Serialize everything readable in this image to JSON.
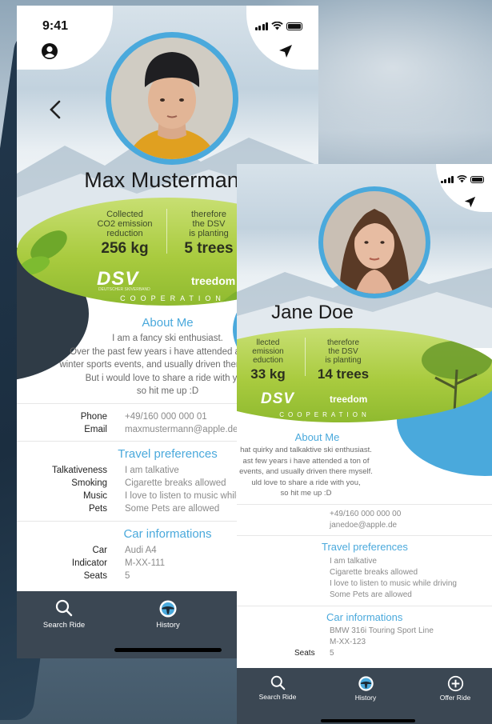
{
  "app": {
    "tabs": [
      {
        "label": "Search Ride",
        "icon": "search-icon"
      },
      {
        "label": "History",
        "icon": "steering-wheel-icon"
      },
      {
        "label": "Offer Ride",
        "icon": "plus-circle-icon"
      }
    ],
    "accent": "#4aa9dc",
    "tabbar_color": "#3b4753"
  },
  "profile1": {
    "time": "9:41",
    "name": "Max Mustermann",
    "eco": {
      "collected_label": "Collected\nCO2 emission\nreduction",
      "collected_value": "256 kg",
      "planting_label": "therefore\nthe DSV\nis planting",
      "planting_value": "5 trees",
      "dsv": "DSV",
      "dsv_sub": "DEUTSCHER SKIVERBAND",
      "treedom": "treedom",
      "cooperation": "COOPERATION"
    },
    "about_title": "About Me",
    "about_text": "I am a fancy ski enthusiast.\nOver the past few years i have attended a ton of\nwinter sports events, and usually driven there myself.\nBut i would love to share a ride with you,\nso hit me up :D",
    "contact": [
      {
        "key": "Phone",
        "value": "+49/160 000 000 01"
      },
      {
        "key": "Email",
        "value": "maxmustermann@apple.de"
      }
    ],
    "travel_title": "Travel preferences",
    "travel": [
      {
        "key": "Talkativeness",
        "value": "I am talkative"
      },
      {
        "key": "Smoking",
        "value": "Cigarette breaks allowed"
      },
      {
        "key": "Music",
        "value": "I love to listen to music while driving"
      },
      {
        "key": "Pets",
        "value": "Some Pets are allowed"
      }
    ],
    "car_title": "Car informations",
    "car": [
      {
        "key": "Car",
        "value": "Audi A4"
      },
      {
        "key": "Indicator",
        "value": "M-XX-111"
      },
      {
        "key": "Seats",
        "value": "5"
      }
    ]
  },
  "profile2": {
    "name": "Jane Doe",
    "eco": {
      "collected_label": "llected\n emission\neduction",
      "collected_value": "33 kg",
      "planting_label": "therefore\nthe DSV\nis planting",
      "planting_value": "14 trees",
      "dsv": "DSV",
      "treedom": "treedom",
      "cooperation": "COOPERATION"
    },
    "about_title": "About Me",
    "about_text": "hat quirky and talkaktive ski enthusiast.\nast few years i have attended a ton of\nevents, and usually driven there myself.\nuld love to share a ride with you,\nso hit me up :D",
    "contact": [
      "+49/160 000 000 00",
      "janedoe@apple.de"
    ],
    "travel_title": "Travel preferences",
    "travel": [
      "I am talkative",
      "Cigarette breaks allowed",
      "I love to listen to music while driving",
      "Some Pets are allowed"
    ],
    "car_title": "Car informations",
    "car": [
      "BMW 316i Touring Sport Line",
      "M-XX-123",
      "5"
    ],
    "seats_label": "Seats"
  }
}
